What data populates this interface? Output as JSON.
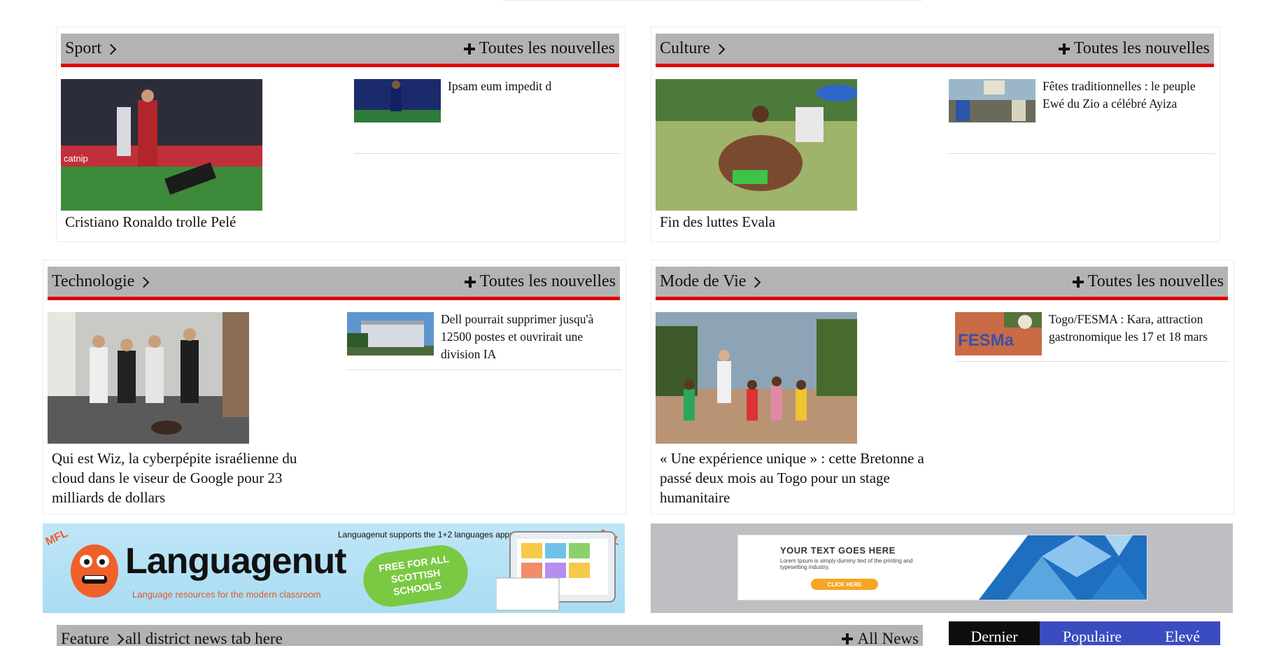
{
  "sections": [
    {
      "category": "Sport",
      "all_news": "Toutes les nouvelles",
      "main_title": "Cristiano Ronaldo trolle Pelé",
      "side": [
        {
          "title": "Ipsam eum impedit d"
        }
      ]
    },
    {
      "category": "Culture",
      "all_news": "Toutes les nouvelles",
      "main_title": "Fin des luttes Evala",
      "side": [
        {
          "title": "Fêtes traditionnelles : le peuple Ewé du Zio a célébré Ayiza"
        }
      ]
    },
    {
      "category": "Technologie",
      "all_news": "Toutes les nouvelles",
      "main_title": "Qui est Wiz, la cyberpépite israélienne du cloud dans le viseur de Google pour 23 milliards de dollars",
      "side": [
        {
          "title": "Dell pourrait supprimer jusqu'à 12500 postes et ouvrirait une division IA"
        }
      ]
    },
    {
      "category": "Mode de Vie",
      "all_news": "Toutes les nouvelles",
      "main_title": "« Une expérience unique » : cette Bretonne a passé deux mois au Togo pour un stage humanitaire",
      "side": [
        {
          "title": "Togo/FESMA : Kara, attraction gastronomique les 17 et 18 mars"
        }
      ]
    }
  ],
  "ads": {
    "languagenut": {
      "brand": "Languagenut",
      "tagline": "Language resources for the modern classroom",
      "supports": "Languagenut supports the 1+2 languages approach",
      "badge": "FREE FOR ALL SCOTTISH SCHOOLS",
      "corner_left": "MFL",
      "corner_right": "EAL"
    },
    "dummy": {
      "headline": "YOUR TEXT GOES HERE",
      "body": "Lorem Ipsum is simply dummy text of the printing and typesetting industry.",
      "button": "CLICK HERE"
    }
  },
  "feature": {
    "label": "Feature",
    "subtitle": "all district news tab here",
    "all_news": "All News"
  },
  "tabs": [
    {
      "label": "Dernier",
      "color": "#0d0d0d"
    },
    {
      "label": "Populaire",
      "color": "#3b4cc0"
    },
    {
      "label": "Elevé",
      "color": "#3b4cc0"
    }
  ],
  "colors": {
    "accent_red": "#e00000",
    "header_gray": "#b3b3b3"
  }
}
